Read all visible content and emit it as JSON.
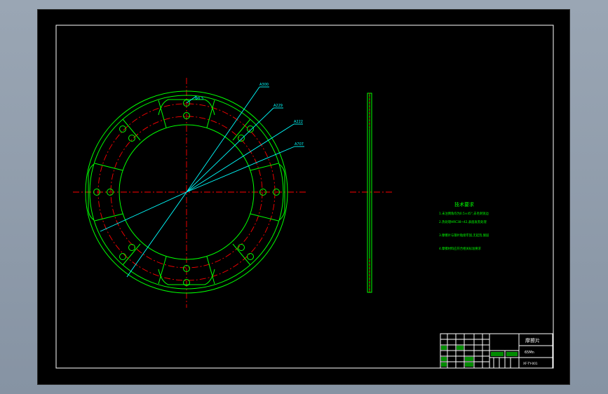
{
  "callouts": [
    "A300",
    "A229",
    "A222",
    "A707",
    "Ф6.5"
  ],
  "notes": {
    "heading": "技术要求",
    "lines": [
      "1.未注倒角均为0.5×45°,去毛刺锐边",
      "2.热处理HRC38~42,表面发黑处理",
      "3.摩擦片与钢片粘接牢固,无起泡,脱层",
      "4.摩擦材料应符合相关标准要求"
    ]
  },
  "title_block": {
    "part_name": "摩擦片",
    "material": "65Mn",
    "drawing_no": "XF-TY-001"
  },
  "colors": {
    "outline": "#00ff00",
    "centerline": "#ff0000",
    "leader": "#00ffff",
    "text": "#ffffff"
  }
}
